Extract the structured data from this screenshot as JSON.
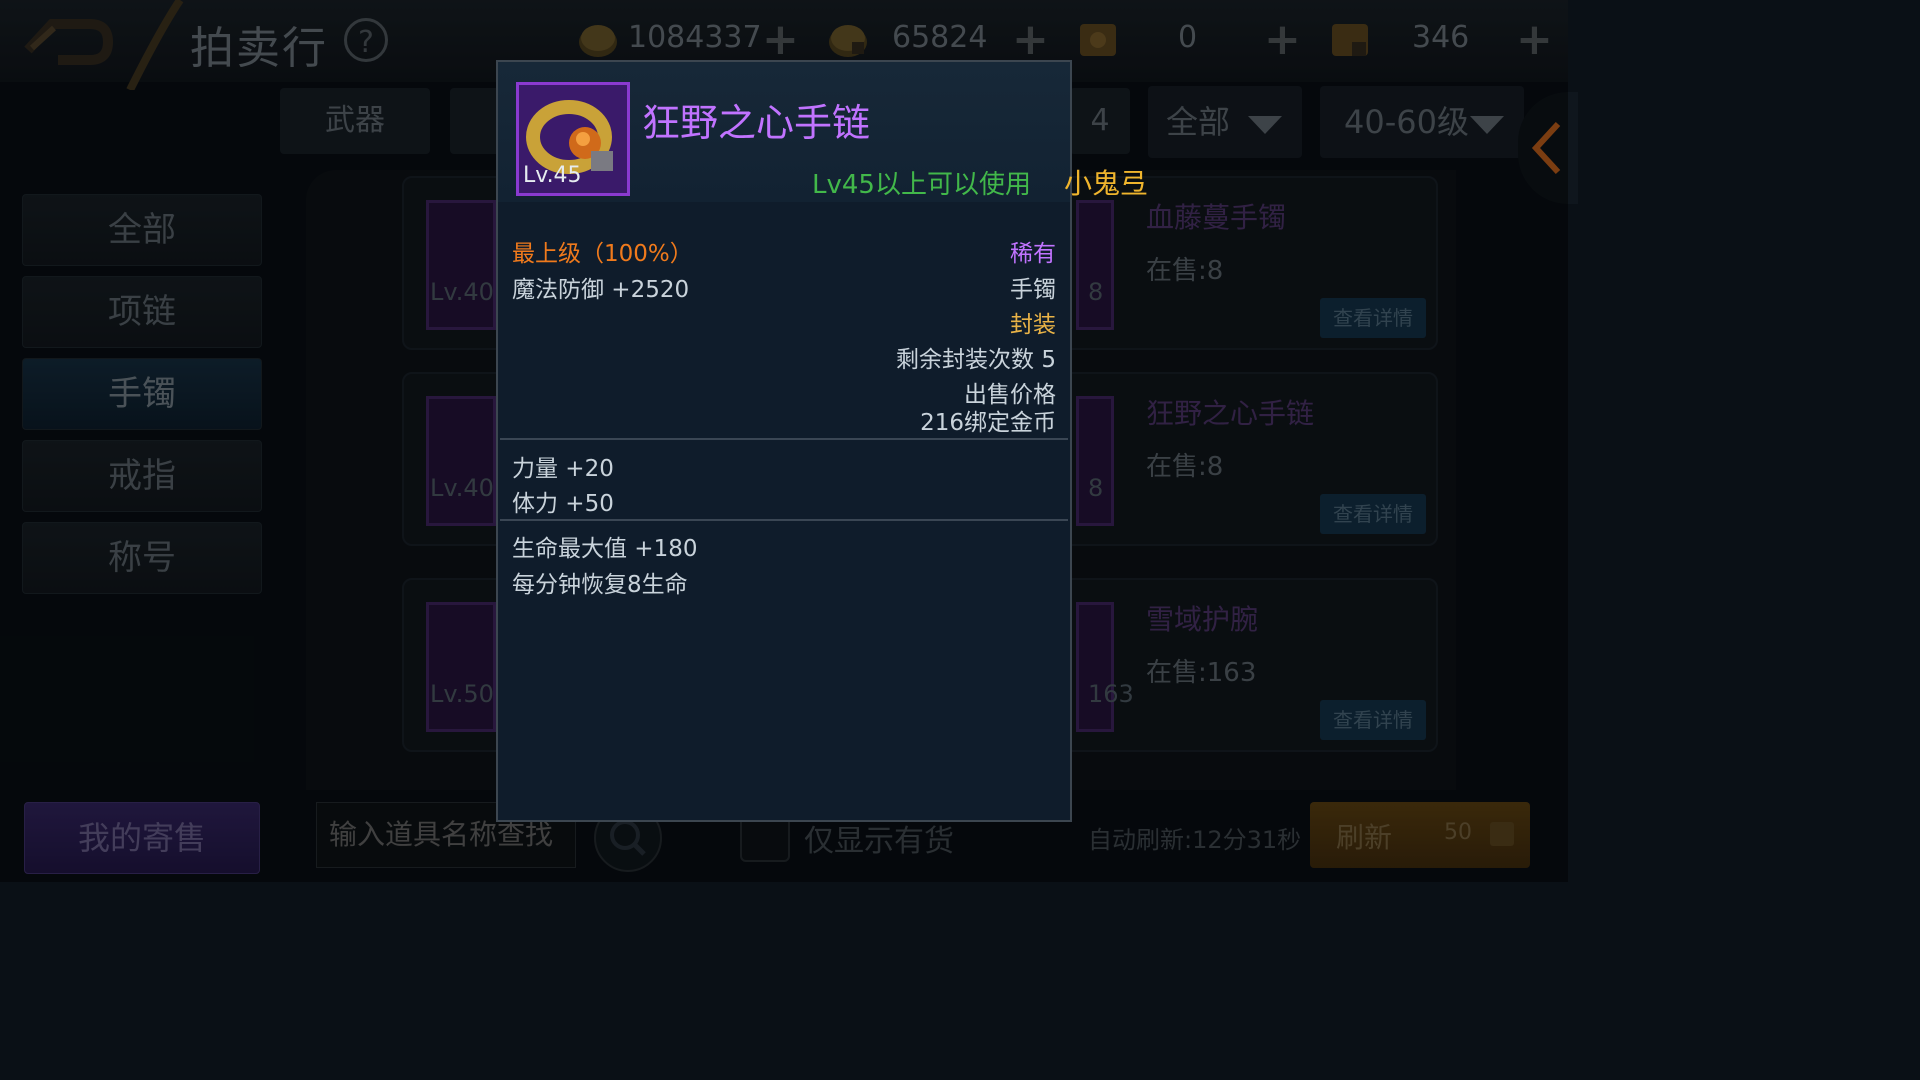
{
  "header": {
    "title": "拍卖行",
    "help": "?",
    "currencies": [
      {
        "icon": "gold-coin-icon",
        "value": "1084337",
        "plus": "+"
      },
      {
        "icon": "bound-coin-icon",
        "value": "65824",
        "plus": "+"
      },
      {
        "icon": "ticket-icon",
        "value": "0",
        "plus": "+"
      },
      {
        "icon": "locked-ticket-icon",
        "value": "346",
        "plus": "+"
      }
    ]
  },
  "filters": {
    "tab_weapon": "武器",
    "tab_partial": "4",
    "dropdown_quality": "全部",
    "dropdown_level": "40-60级"
  },
  "categories": [
    "全部",
    "项链",
    "手镯",
    "戒指",
    "称号"
  ],
  "active_category": "手镯",
  "items": [
    {
      "level": "Lv.40",
      "name": "血藤蔓手镯",
      "stock": "在售:8",
      "count": "8",
      "detail": "查看详情"
    },
    {
      "level": "Lv.40",
      "name": "狂野之心手链",
      "stock": "在售:8",
      "count": "8",
      "detail": "查看详情"
    },
    {
      "level": "Lv.50",
      "name": "雪域护腕",
      "stock": "在售:163",
      "count": "163",
      "detail": "查看详情"
    }
  ],
  "bottom": {
    "my_sales": "我的寄售",
    "search_placeholder": "输入道具名称查找",
    "in_stock_only": "仅显示有货",
    "auto_refresh": "自动刷新:12分31秒",
    "refresh": "刷新",
    "refresh_cost": "50"
  },
  "tooltip": {
    "level": "Lv.45",
    "name": "狂野之心手链",
    "requirement": "Lv45以上可以使用",
    "owner": "小鬼弖",
    "grade": "最上级（100%）",
    "rarity": "稀有",
    "main_stat": "魔法防御 +2520",
    "type": "手镯",
    "sealed": "封装",
    "seal_remaining": "剩余封装次数 5",
    "sell_price_label": "出售价格",
    "sell_price": "216绑定金币",
    "stats": [
      "力量 +20",
      "体力 +50"
    ],
    "extra_stats": [
      "生命最大值 +180",
      "每分钟恢复8生命"
    ]
  },
  "colors": {
    "tooltip_name": "#c173ff",
    "requirement": "#42b84a",
    "owner": "#f0b52d",
    "grade": "#f07a1c",
    "rarity": "#c173ff",
    "sealed": "#e9b347",
    "text": "#c9d3db"
  }
}
